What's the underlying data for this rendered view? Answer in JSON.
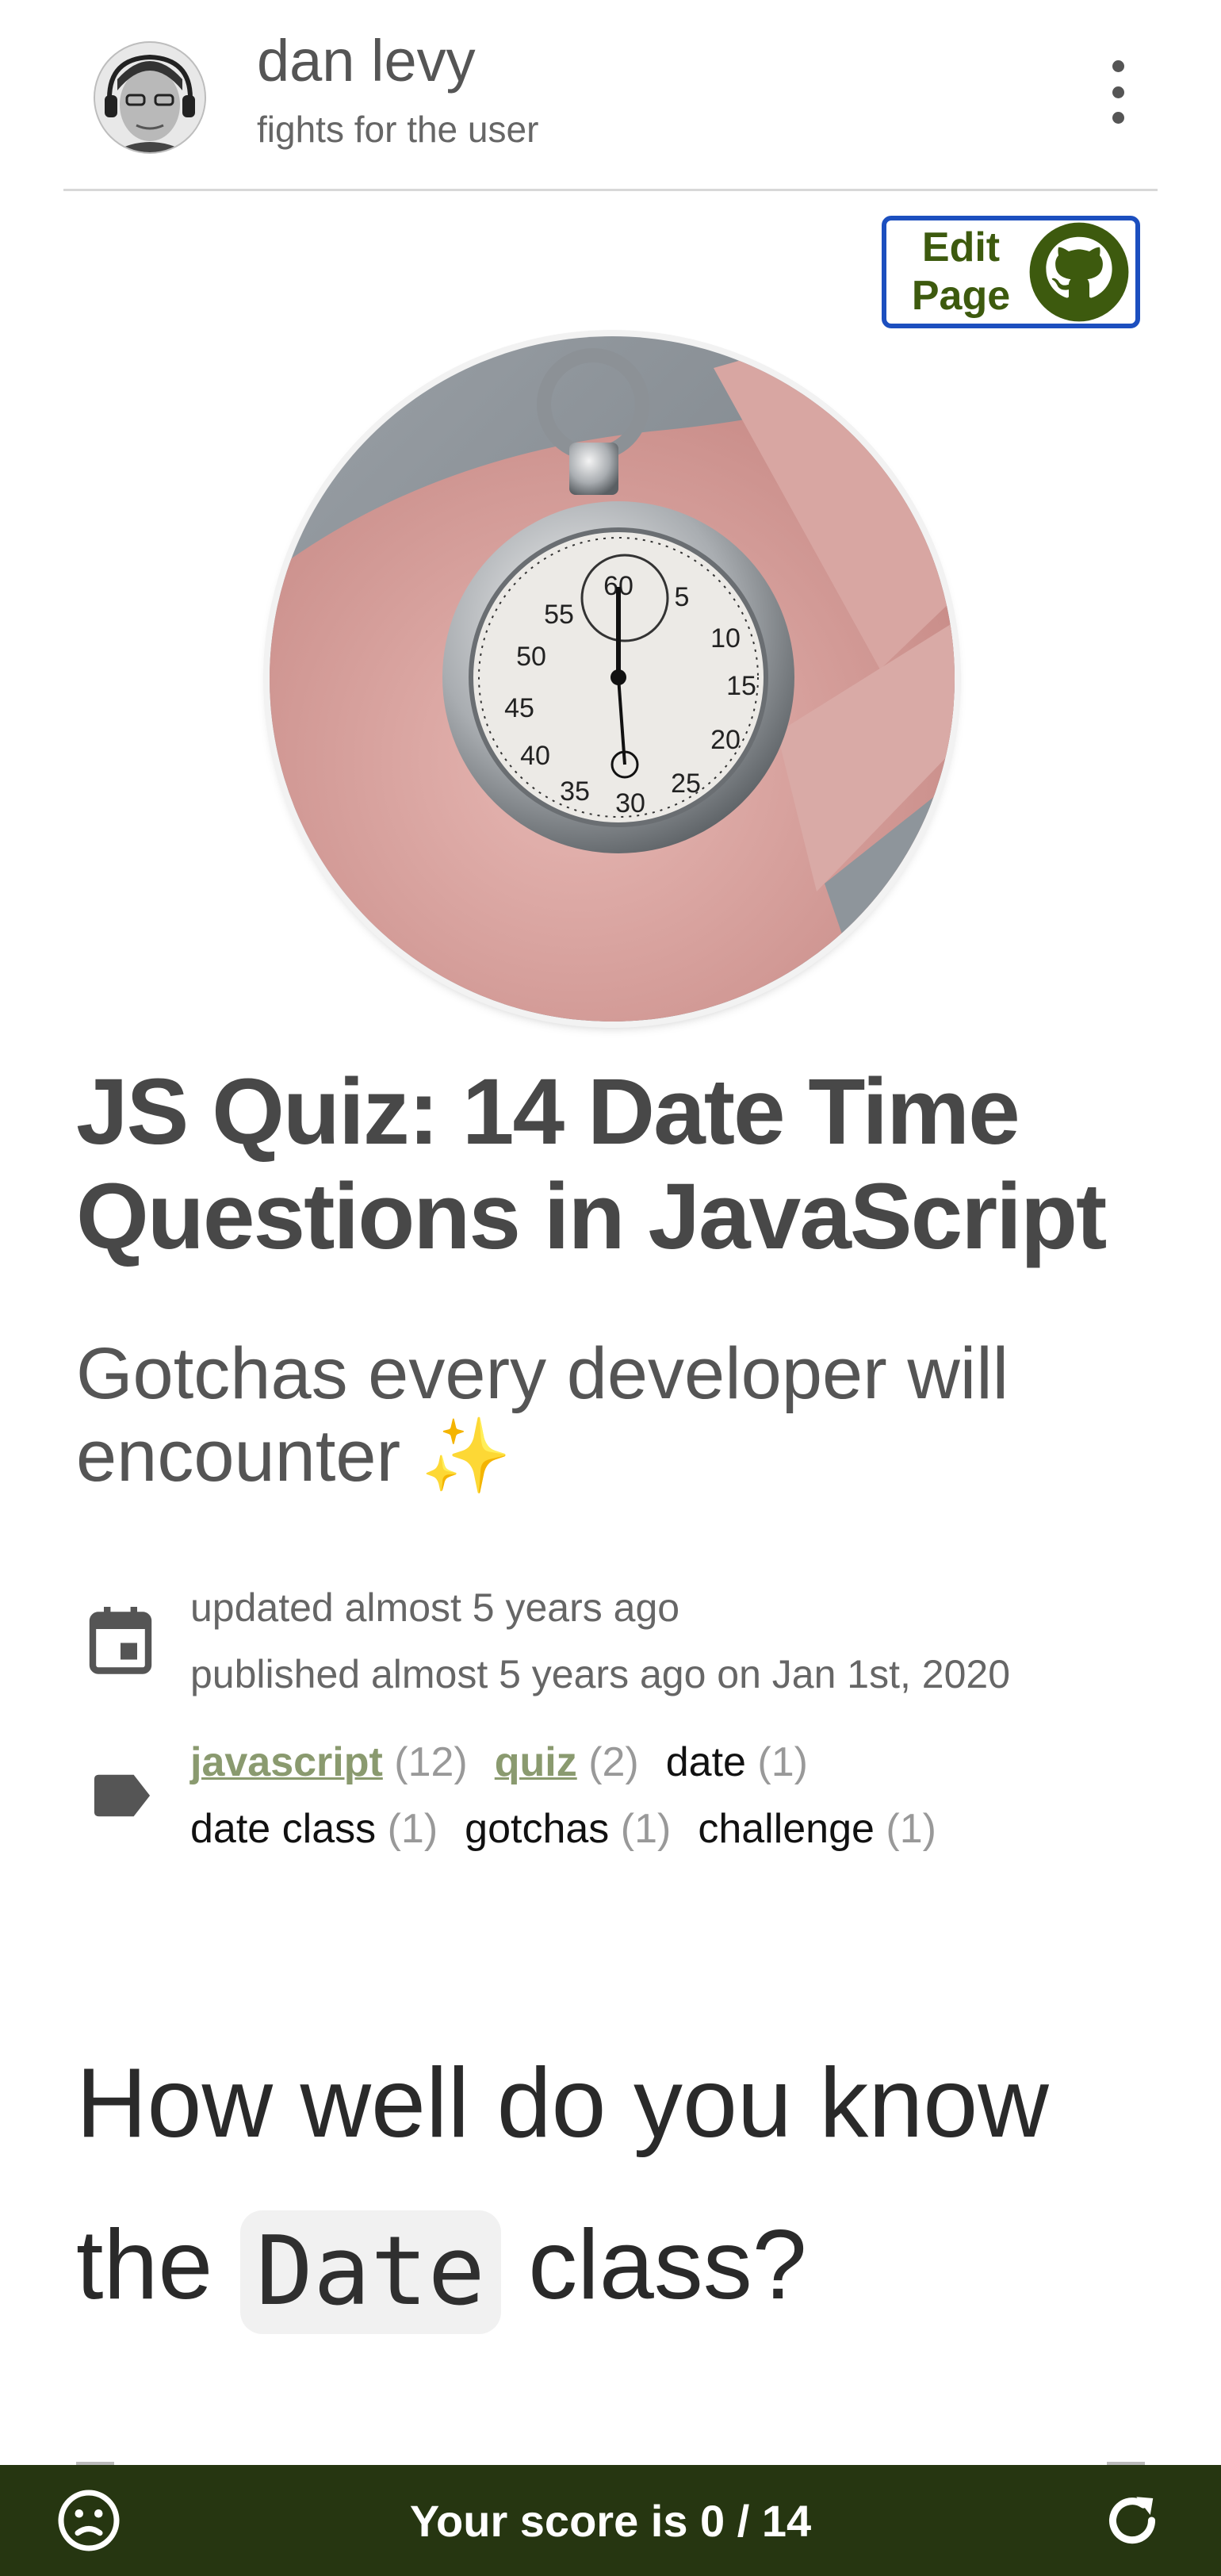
{
  "header": {
    "site_title": "dan levy",
    "tagline": "fights for the user"
  },
  "edit_page": {
    "label": "Edit\nPage",
    "icon": "github-icon"
  },
  "article": {
    "title": "JS Quiz: 14 Date Time Questions in JavaScript",
    "subtitle": "Gotchas every developer will encounter ✨",
    "updated": "updated almost 5 years ago",
    "published": "published almost 5 years ago on Jan 1st, 2020",
    "tags": [
      {
        "name": "javascript",
        "count": "(12)",
        "link": true
      },
      {
        "name": "quiz",
        "count": "(2)",
        "link": true
      },
      {
        "name": "date",
        "count": "(1)",
        "link": false
      },
      {
        "name": "date class",
        "count": "(1)",
        "link": false
      },
      {
        "name": "gotchas",
        "count": "(1)",
        "link": false
      },
      {
        "name": "challenge",
        "count": "(1)",
        "link": false
      }
    ],
    "section_heading_before": "How well do you know the",
    "section_heading_code": "Date",
    "section_heading_after": "class?"
  },
  "score_bar": {
    "text": "Your score is 0 / 14"
  },
  "colors": {
    "score_bar_bg": "#263611",
    "edit_border": "#1c4fbf",
    "github_green": "#3d5a0e",
    "tag_link": "#8a9a6f"
  }
}
